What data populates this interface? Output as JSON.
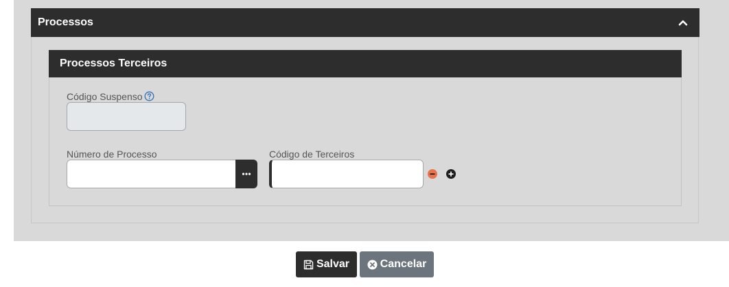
{
  "panel": {
    "title": "Processos",
    "collapse_icon": "chevron-up-icon"
  },
  "subpanel": {
    "title": "Processos Terceiros"
  },
  "fields": {
    "codigo_suspenso": {
      "label": "Código Suspenso",
      "value": "",
      "help_icon": "question-circle-icon"
    },
    "numero_processo": {
      "label": "Número de Processo",
      "value": "",
      "lookup_icon": "ellipsis-icon"
    },
    "codigo_terceiros": {
      "label": "Código de Terceiros",
      "value": ""
    }
  },
  "row_actions": {
    "remove_icon": "minus-circle-icon",
    "add_icon": "plus-circle-icon"
  },
  "footer": {
    "save_label": "Salvar",
    "save_icon": "floppy-disk-icon",
    "cancel_label": "Cancelar",
    "cancel_icon": "x-circle-icon"
  },
  "colors": {
    "header_bg": "#2d2d2d",
    "page_bg": "#d9d9d9",
    "remove_accent": "#e8734a",
    "cancel_bg": "#6c757d",
    "help_icon": "#2f6fb5"
  }
}
